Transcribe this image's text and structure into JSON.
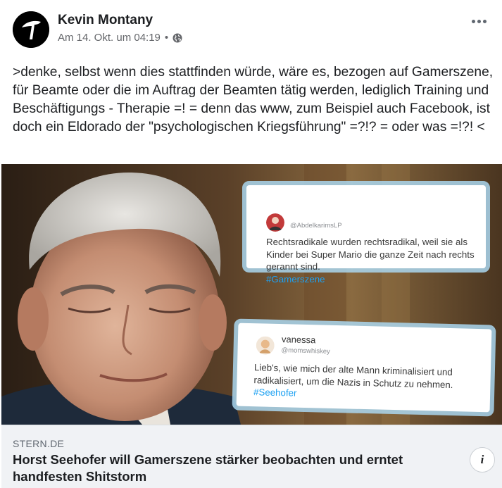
{
  "post": {
    "author": "Kevin Montany",
    "timestamp": "Am 14. Okt. um 04:19",
    "separator": "•",
    "privacy_icon": "globe-icon",
    "more_icon": "more-options-icon",
    "text": ">denke, selbst wenn dies stattfinden würde, wäre es, bezogen auf Gamerszene, für Beamte oder die im Auftrag der Beamten tätig werden, lediglich Training und Beschäftigungs - Therapie =! = denn das www, zum Beispiel auch Facebook, ist doch ein Eldorado der \"psychologischen Kriegsführung\" =?!? = oder was =!?! <"
  },
  "image": {
    "tweets": [
      {
        "handle": "@AbdelkarimsLP",
        "text": "Rechtsradikale wurden rechtsradikal, weil sie als Kinder bei Super Mario die ganze Zeit nach rechts gerannt sind.",
        "hashtag": "#Gamerszene"
      },
      {
        "name": "vanessa",
        "handle": "@momswhiskey",
        "text": "Lieb's, wie mich der alte Mann kriminalisiert und radikalisiert, um die Nazis in Schutz zu nehmen.",
        "hashtag": "#Seehofer"
      }
    ]
  },
  "link": {
    "domain": "STERN.DE",
    "title": "Horst Seehofer will Gamerszene stärker beobachten und erntet handfesten Shitstorm",
    "info_label": "i"
  },
  "colors": {
    "hashtag": "#1da1f2",
    "tweet_frame": "#aad7f0",
    "link_bg": "#f0f2f5",
    "meta_text": "#65676b"
  }
}
